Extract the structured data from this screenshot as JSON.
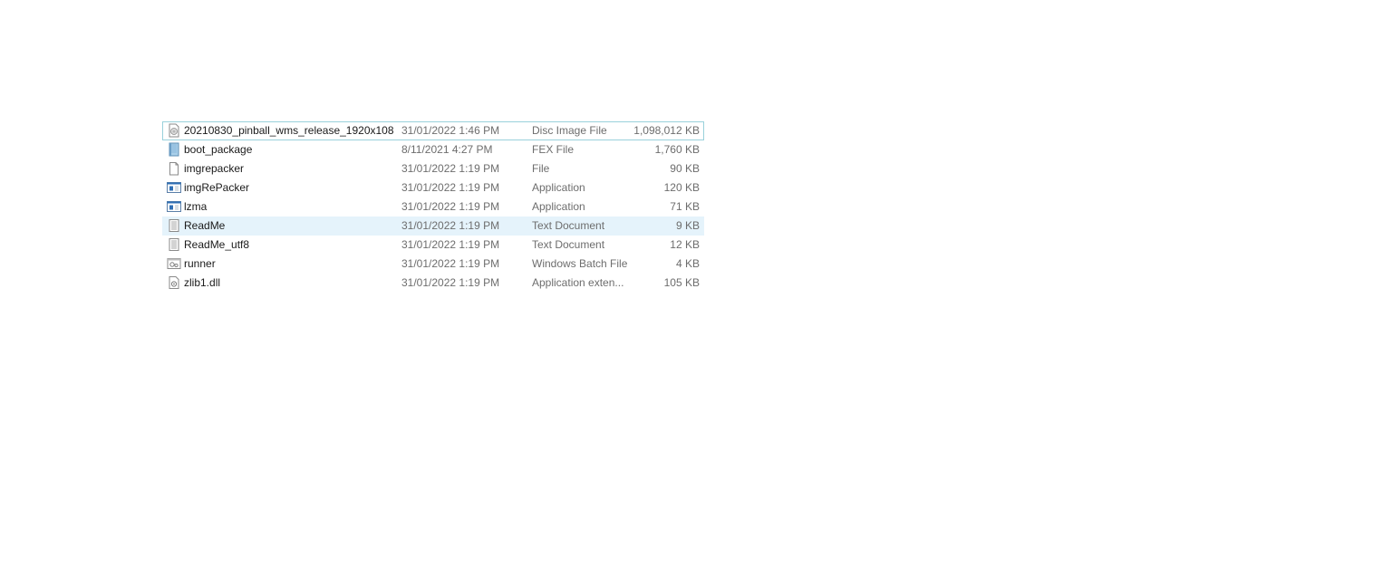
{
  "files": [
    {
      "name": "20210830_pinball_wms_release_1920x108...",
      "date": "31/01/2022 1:46 PM",
      "type": "Disc Image File",
      "size": "1,098,012 KB",
      "icon": "disc-image-icon"
    },
    {
      "name": "boot_package",
      "date": "8/11/2021 4:27 PM",
      "type": "FEX File",
      "size": "1,760 KB",
      "icon": "fex-file-icon"
    },
    {
      "name": "imgrepacker",
      "date": "31/01/2022 1:19 PM",
      "type": "File",
      "size": "90 KB",
      "icon": "blank-file-icon"
    },
    {
      "name": "imgRePacker",
      "date": "31/01/2022 1:19 PM",
      "type": "Application",
      "size": "120 KB",
      "icon": "application-icon"
    },
    {
      "name": "lzma",
      "date": "31/01/2022 1:19 PM",
      "type": "Application",
      "size": "71 KB",
      "icon": "application-icon"
    },
    {
      "name": "ReadMe",
      "date": "31/01/2022 1:19 PM",
      "type": "Text Document",
      "size": "9 KB",
      "icon": "text-document-icon"
    },
    {
      "name": "ReadMe_utf8",
      "date": "31/01/2022 1:19 PM",
      "type": "Text Document",
      "size": "12 KB",
      "icon": "text-document-icon"
    },
    {
      "name": "runner",
      "date": "31/01/2022 1:19 PM",
      "type": "Windows Batch File",
      "size": "4 KB",
      "icon": "batch-file-icon"
    },
    {
      "name": "zlib1.dll",
      "date": "31/01/2022 1:19 PM",
      "type": "Application exten...",
      "size": "105 KB",
      "icon": "dll-file-icon"
    }
  ],
  "colors": {
    "focus_border": "#99d1db",
    "hover_background": "#e5f3fb",
    "secondary_text": "#6d6d6d"
  }
}
